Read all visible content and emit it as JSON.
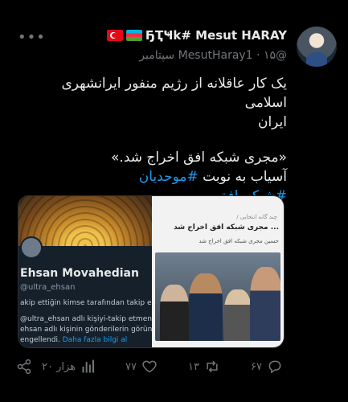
{
  "tweet": {
    "more_label": "•••",
    "display_name": "ñ╝ñ╝🇹🇷🇦🇿 ꎤᕮᕼᴋ# Mesut HARAY",
    "display_name_text": "ҔҬҸk# Mesut HARAY",
    "handle": "@MesutHaray1",
    "date": "۱۵ سپتامبر",
    "separator": "·",
    "text_line1": "یک کار عاقلانه از رژیم منفور ایرانشهری اسلامی",
    "text_line2": "ایران",
    "text_line3": "«مجری شبکه افق اخراج شد.»",
    "text_line4_prefix": "آسیاب به نوبت ",
    "hashtag1": "#موحدیان",
    "hashtag2": "#شبکه_افق"
  },
  "media": {
    "left": {
      "name": "Ehsan Movahedian",
      "handle": "@ultra_ehsan",
      "line1": "akip ettiğin kimse tarafından takip edilmiyor",
      "line2": "@ultra_ehsan adlı kişiyi-takip etmen ve @ultra",
      "line3": "ehsan adlı kişinin gönderilerin görüntülemen",
      "line4": "engellendi.",
      "link": "Daha fazla bilgi al"
    },
    "right": {
      "label": "چند گانه انتخابی /",
      "title": "... مجری شبکه افق اخراج شد",
      "subtitle": "حسین مجری شبکه افق اخراج شد"
    }
  },
  "actions": {
    "views": "۲۰ هزار",
    "likes": "۷۷",
    "retweets": "۱۳",
    "replies": "۶۷"
  },
  "colors": {
    "background": "#000000",
    "text": "#e7e9ea",
    "muted": "#71767b",
    "accent": "#1d9bf0"
  }
}
